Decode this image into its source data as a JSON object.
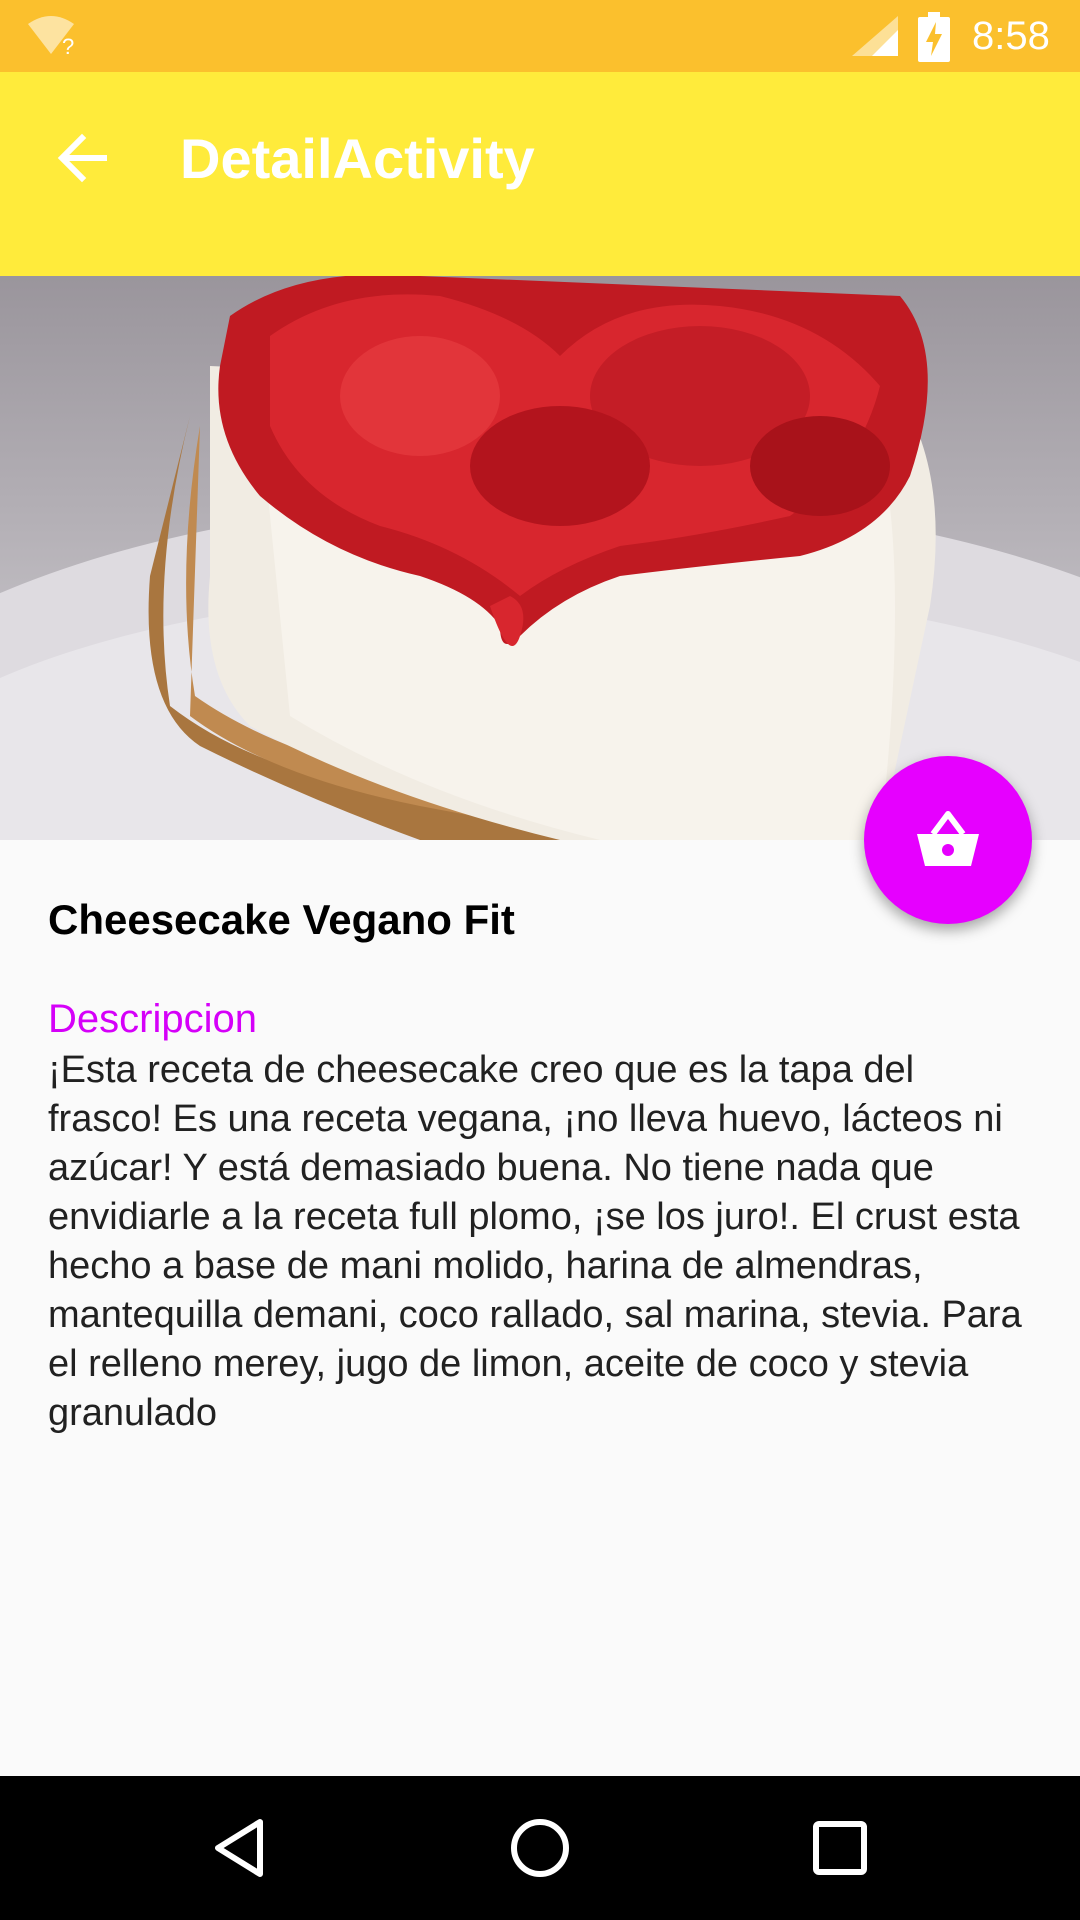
{
  "status_bar": {
    "time": "8:58",
    "wifi_label": "?"
  },
  "app_bar": {
    "title": "DetailActivity",
    "back_icon": "arrow-back-icon"
  },
  "hero": {
    "image": "cheesecake-with-strawberries"
  },
  "fab": {
    "icon": "shopping-basket-icon",
    "color": "#e600ff"
  },
  "recipe": {
    "title": "Cheesecake Vegano Fit",
    "description_label": "Descripcion",
    "description": "¡Esta receta de cheesecake creo que es la tapa del frasco! Es una receta vegana, ¡no lleva huevo, lácteos ni azúcar! Y está demasiado buena. No tiene nada que envidiarle a la receta full plomo, ¡se los juro!. El crust esta hecho a base de mani molido, harina de almendras, mantequilla demani, coco rallado, sal marina, stevia. Para el relleno merey, jugo de limon, aceite de coco y stevia granulado"
  },
  "colors": {
    "status_bar": "#fbc02d",
    "app_bar": "#ffeb3b",
    "accent": "#d500f9"
  }
}
